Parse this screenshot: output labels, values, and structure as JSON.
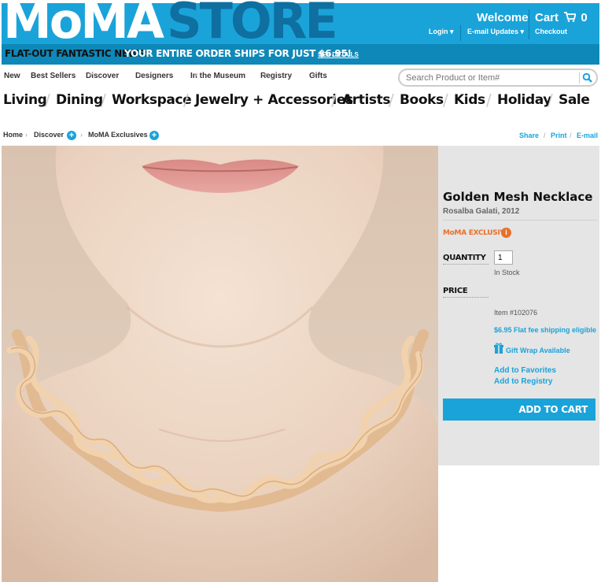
{
  "header": {
    "logo_moma": "MoMA",
    "logo_store": "STORE",
    "welcome": "Welcome",
    "cart_label": "Cart",
    "cart_count": "0",
    "login": "Login ▾",
    "email_updates": "E-mail Updates ▾",
    "checkout": "Checkout"
  },
  "banner": {
    "lead": "FLAT-OUT FANTASTIC NEWS:",
    "message": "YOUR ENTIRE ORDER SHIPS FOR JUST $6.95!",
    "link": "SEE DETAILS"
  },
  "topnav": [
    "New",
    "Best Sellers",
    "Discover",
    "Designers",
    "In the Museum",
    "Registry",
    "Gifts"
  ],
  "search": {
    "placeholder": "Search Product or Item#"
  },
  "categories": [
    "Living",
    "Dining",
    "Workspace",
    "Jewelry + Accessories",
    "Artists",
    "Books",
    "Kids",
    "Holiday",
    "Sale"
  ],
  "breadcrumb": [
    "Home",
    "Discover",
    "MoMA Exclusives"
  ],
  "share_links": [
    "Share",
    "Print",
    "E-mail"
  ],
  "product": {
    "title": "Golden Mesh Necklace",
    "designer": "Rosalba Galati, 2012",
    "exclusive": "MoMA EXCLUSIVE",
    "quantity_label": "QUANTITY",
    "quantity": "1",
    "stock": "In Stock",
    "price_label": "PRICE",
    "item_no": "Item #102076",
    "shipping": "$6.95 Flat fee shipping eligible",
    "gift_wrap": "Gift Wrap Available",
    "add_favorites": "Add to Favorites",
    "add_registry": "Add to Registry",
    "add_to_cart": "ADD TO CART"
  },
  "colors": {
    "brand_blue": "#1aa3d9",
    "banner_blue": "#0e88b8",
    "exclusive_orange": "#e8702a"
  }
}
